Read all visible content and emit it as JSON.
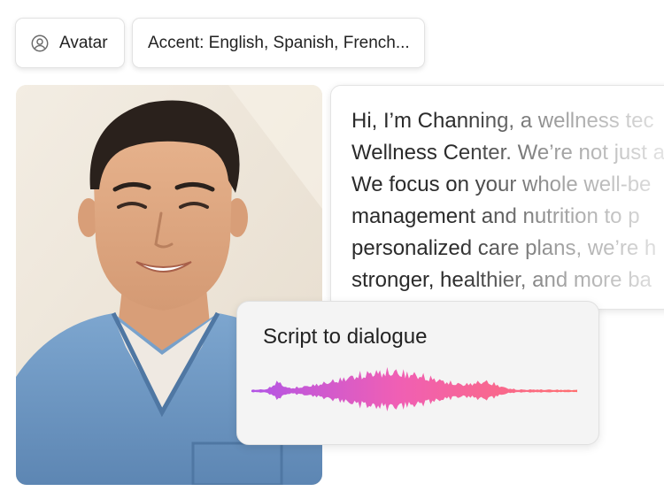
{
  "chips": {
    "avatar_label": "Avatar",
    "avatar_icon": "user-circle-icon",
    "accent_label": "Accent: English, Spanish, French..."
  },
  "script": {
    "text": "Hi, I’m Channing, a wellness tec\nWellness Center. We’re not just a\nWe focus on your whole well-be\nmanagement and nutrition to p\npersonalized care plans, we’re h\nstronger, healthier, and more ba"
  },
  "dialogue": {
    "title": "Script to dialogue",
    "waveform_colors": [
      "#b255e6",
      "#f05fb4",
      "#ff6f6f"
    ]
  }
}
